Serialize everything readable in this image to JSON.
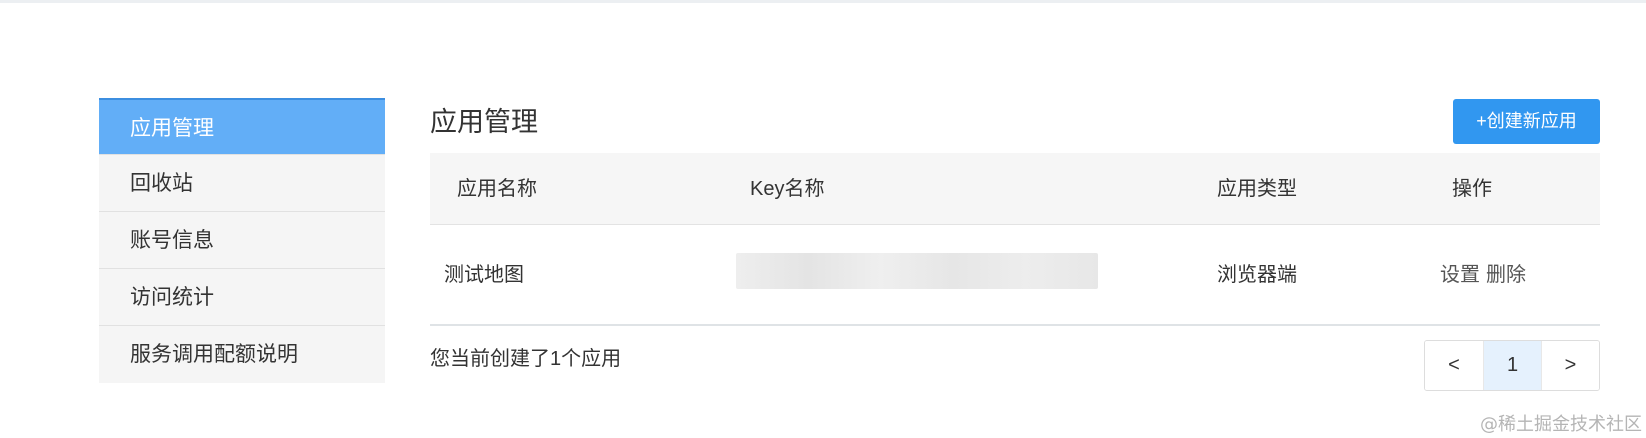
{
  "sidebar": {
    "items": [
      {
        "label": "应用管理",
        "active": true
      },
      {
        "label": "回收站"
      },
      {
        "label": "账号信息"
      },
      {
        "label": "访问统计"
      },
      {
        "label": "服务调用配额说明"
      }
    ]
  },
  "main": {
    "title": "应用管理",
    "create_button": "+创建新应用",
    "table": {
      "headers": [
        "应用名称",
        "Key名称",
        "应用类型",
        "操作"
      ],
      "rows": [
        {
          "name": "测试地图",
          "key": "",
          "type": "浏览器端",
          "actions": [
            "设置",
            "删除"
          ]
        }
      ]
    },
    "summary": "您当前创建了1个应用",
    "pagination": {
      "prev": "<",
      "current": "1",
      "next": ">"
    }
  },
  "watermark": "@稀土掘金技术社区",
  "colors": {
    "accent": "#3197f0",
    "sidebar_active": "#62aef7"
  }
}
